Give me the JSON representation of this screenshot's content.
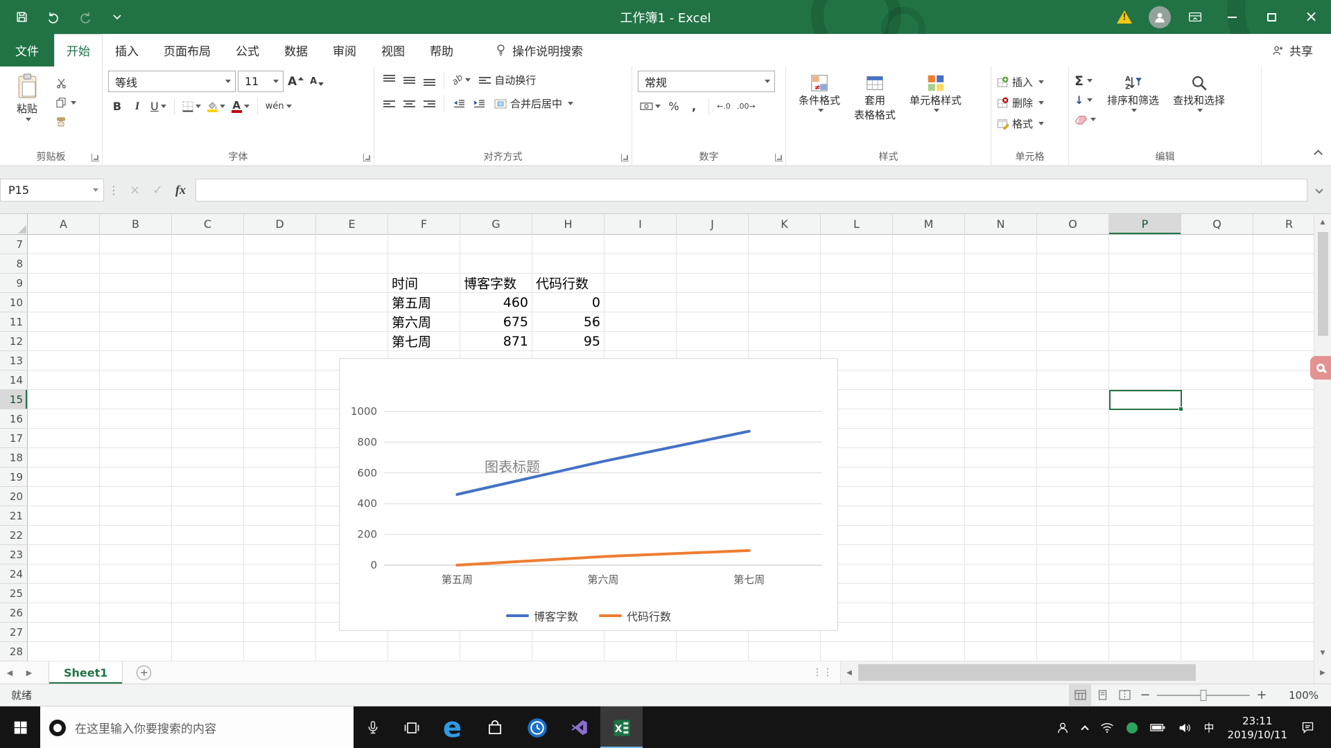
{
  "accent": {
    "excel_green": "#217346",
    "series_blue": "#4472C4",
    "series_orange": "#ED7D31"
  },
  "title_bar": {
    "title": "工作簿1 -  Excel"
  },
  "ribbon_tabs": {
    "file": "文件",
    "tabs": [
      "开始",
      "插入",
      "页面布局",
      "公式",
      "数据",
      "审阅",
      "视图",
      "帮助"
    ],
    "active_tab": "开始",
    "tell_me": "操作说明搜索",
    "share": "共享"
  },
  "ribbon": {
    "clipboard": {
      "group_label": "剪贴板",
      "paste_label": "粘贴"
    },
    "font": {
      "group_label": "字体",
      "font_name": "等线",
      "font_size": "11",
      "bold": "B",
      "italic": "I",
      "underline": "U",
      "phonetic": "wén"
    },
    "alignment": {
      "group_label": "对齐方式",
      "wrap_text": "自动换行",
      "merge_center": "合并后居中"
    },
    "number": {
      "group_label": "数字",
      "format": "常规",
      "percent": "%",
      "comma": ",",
      "increase_decimal": "←.0",
      "decrease_decimal": ".00→"
    },
    "styles": {
      "group_label": "样式",
      "conditional_format": "条件格式",
      "format_as_table_1": "套用",
      "format_as_table_2": "表格格式",
      "cell_styles": "单元格样式"
    },
    "cells": {
      "group_label": "单元格",
      "insert": "插入",
      "delete": "删除",
      "format": "格式"
    },
    "editing": {
      "group_label": "编辑",
      "autosum": "Σ",
      "sort_filter": "排序和筛选",
      "find_select": "查找和选择"
    }
  },
  "formula_bar": {
    "name_box": "P15",
    "cancel": "×",
    "enter": "✓",
    "fx": "fx",
    "formula": ""
  },
  "grid": {
    "columns": [
      "A",
      "B",
      "C",
      "D",
      "E",
      "F",
      "G",
      "H",
      "I",
      "J",
      "K",
      "L",
      "M",
      "N",
      "O",
      "P",
      "Q",
      "R"
    ],
    "row_start": 7,
    "row_end": 28,
    "selection": {
      "ref": "P15",
      "column": "P",
      "row": 15
    },
    "cells": [
      {
        "ref": "F9",
        "value": "时间",
        "align": "left"
      },
      {
        "ref": "G9",
        "value": "博客字数",
        "align": "left"
      },
      {
        "ref": "H9",
        "value": "代码行数",
        "align": "left"
      },
      {
        "ref": "F10",
        "value": "第五周",
        "align": "left"
      },
      {
        "ref": "G10",
        "value": "460",
        "align": "right"
      },
      {
        "ref": "H10",
        "value": "0",
        "align": "right"
      },
      {
        "ref": "F11",
        "value": "第六周",
        "align": "left"
      },
      {
        "ref": "G11",
        "value": "675",
        "align": "right"
      },
      {
        "ref": "H11",
        "value": "56",
        "align": "right"
      },
      {
        "ref": "F12",
        "value": "第七周",
        "align": "left"
      },
      {
        "ref": "G12",
        "value": "871",
        "align": "right"
      },
      {
        "ref": "H12",
        "value": "95",
        "align": "right"
      }
    ]
  },
  "chart_data": {
    "type": "line",
    "title": "图表标题",
    "categories": [
      "第五周",
      "第六周",
      "第七周"
    ],
    "series": [
      {
        "name": "博客字数",
        "color": "#4472C4",
        "values": [
          460,
          675,
          871
        ]
      },
      {
        "name": "代码行数",
        "color": "#ED7D31",
        "values": [
          0,
          56,
          95
        ]
      }
    ],
    "ylim": [
      0,
      1000
    ],
    "yticks": [
      0,
      200,
      400,
      600,
      800,
      1000
    ],
    "grid": true,
    "legend_position": "bottom"
  },
  "sheet_bar": {
    "tabs": [
      "Sheet1"
    ],
    "active": "Sheet1"
  },
  "status_bar": {
    "mode": "就绪",
    "zoom_level": "100%"
  },
  "taskbar": {
    "search_text": "在这里输入你要搜索的内容",
    "ime": "中",
    "time": "23:11",
    "date": "2019/10/11"
  }
}
